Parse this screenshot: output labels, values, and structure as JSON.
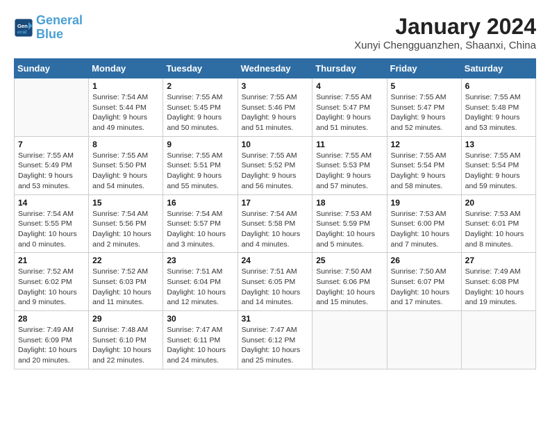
{
  "header": {
    "logo_line1": "General",
    "logo_line2": "Blue",
    "title": "January 2024",
    "subtitle": "Xunyi Chengguanzhen, Shaanxi, China"
  },
  "days_of_week": [
    "Sunday",
    "Monday",
    "Tuesday",
    "Wednesday",
    "Thursday",
    "Friday",
    "Saturday"
  ],
  "weeks": [
    [
      {
        "day": "",
        "info": ""
      },
      {
        "day": "1",
        "info": "Sunrise: 7:54 AM\nSunset: 5:44 PM\nDaylight: 9 hours\nand 49 minutes."
      },
      {
        "day": "2",
        "info": "Sunrise: 7:55 AM\nSunset: 5:45 PM\nDaylight: 9 hours\nand 50 minutes."
      },
      {
        "day": "3",
        "info": "Sunrise: 7:55 AM\nSunset: 5:46 PM\nDaylight: 9 hours\nand 51 minutes."
      },
      {
        "day": "4",
        "info": "Sunrise: 7:55 AM\nSunset: 5:47 PM\nDaylight: 9 hours\nand 51 minutes."
      },
      {
        "day": "5",
        "info": "Sunrise: 7:55 AM\nSunset: 5:47 PM\nDaylight: 9 hours\nand 52 minutes."
      },
      {
        "day": "6",
        "info": "Sunrise: 7:55 AM\nSunset: 5:48 PM\nDaylight: 9 hours\nand 53 minutes."
      }
    ],
    [
      {
        "day": "7",
        "info": "Sunrise: 7:55 AM\nSunset: 5:49 PM\nDaylight: 9 hours\nand 53 minutes."
      },
      {
        "day": "8",
        "info": "Sunrise: 7:55 AM\nSunset: 5:50 PM\nDaylight: 9 hours\nand 54 minutes."
      },
      {
        "day": "9",
        "info": "Sunrise: 7:55 AM\nSunset: 5:51 PM\nDaylight: 9 hours\nand 55 minutes."
      },
      {
        "day": "10",
        "info": "Sunrise: 7:55 AM\nSunset: 5:52 PM\nDaylight: 9 hours\nand 56 minutes."
      },
      {
        "day": "11",
        "info": "Sunrise: 7:55 AM\nSunset: 5:53 PM\nDaylight: 9 hours\nand 57 minutes."
      },
      {
        "day": "12",
        "info": "Sunrise: 7:55 AM\nSunset: 5:54 PM\nDaylight: 9 hours\nand 58 minutes."
      },
      {
        "day": "13",
        "info": "Sunrise: 7:55 AM\nSunset: 5:54 PM\nDaylight: 9 hours\nand 59 minutes."
      }
    ],
    [
      {
        "day": "14",
        "info": "Sunrise: 7:54 AM\nSunset: 5:55 PM\nDaylight: 10 hours\nand 0 minutes."
      },
      {
        "day": "15",
        "info": "Sunrise: 7:54 AM\nSunset: 5:56 PM\nDaylight: 10 hours\nand 2 minutes."
      },
      {
        "day": "16",
        "info": "Sunrise: 7:54 AM\nSunset: 5:57 PM\nDaylight: 10 hours\nand 3 minutes."
      },
      {
        "day": "17",
        "info": "Sunrise: 7:54 AM\nSunset: 5:58 PM\nDaylight: 10 hours\nand 4 minutes."
      },
      {
        "day": "18",
        "info": "Sunrise: 7:53 AM\nSunset: 5:59 PM\nDaylight: 10 hours\nand 5 minutes."
      },
      {
        "day": "19",
        "info": "Sunrise: 7:53 AM\nSunset: 6:00 PM\nDaylight: 10 hours\nand 7 minutes."
      },
      {
        "day": "20",
        "info": "Sunrise: 7:53 AM\nSunset: 6:01 PM\nDaylight: 10 hours\nand 8 minutes."
      }
    ],
    [
      {
        "day": "21",
        "info": "Sunrise: 7:52 AM\nSunset: 6:02 PM\nDaylight: 10 hours\nand 9 minutes."
      },
      {
        "day": "22",
        "info": "Sunrise: 7:52 AM\nSunset: 6:03 PM\nDaylight: 10 hours\nand 11 minutes."
      },
      {
        "day": "23",
        "info": "Sunrise: 7:51 AM\nSunset: 6:04 PM\nDaylight: 10 hours\nand 12 minutes."
      },
      {
        "day": "24",
        "info": "Sunrise: 7:51 AM\nSunset: 6:05 PM\nDaylight: 10 hours\nand 14 minutes."
      },
      {
        "day": "25",
        "info": "Sunrise: 7:50 AM\nSunset: 6:06 PM\nDaylight: 10 hours\nand 15 minutes."
      },
      {
        "day": "26",
        "info": "Sunrise: 7:50 AM\nSunset: 6:07 PM\nDaylight: 10 hours\nand 17 minutes."
      },
      {
        "day": "27",
        "info": "Sunrise: 7:49 AM\nSunset: 6:08 PM\nDaylight: 10 hours\nand 19 minutes."
      }
    ],
    [
      {
        "day": "28",
        "info": "Sunrise: 7:49 AM\nSunset: 6:09 PM\nDaylight: 10 hours\nand 20 minutes."
      },
      {
        "day": "29",
        "info": "Sunrise: 7:48 AM\nSunset: 6:10 PM\nDaylight: 10 hours\nand 22 minutes."
      },
      {
        "day": "30",
        "info": "Sunrise: 7:47 AM\nSunset: 6:11 PM\nDaylight: 10 hours\nand 24 minutes."
      },
      {
        "day": "31",
        "info": "Sunrise: 7:47 AM\nSunset: 6:12 PM\nDaylight: 10 hours\nand 25 minutes."
      },
      {
        "day": "",
        "info": ""
      },
      {
        "day": "",
        "info": ""
      },
      {
        "day": "",
        "info": ""
      }
    ]
  ]
}
